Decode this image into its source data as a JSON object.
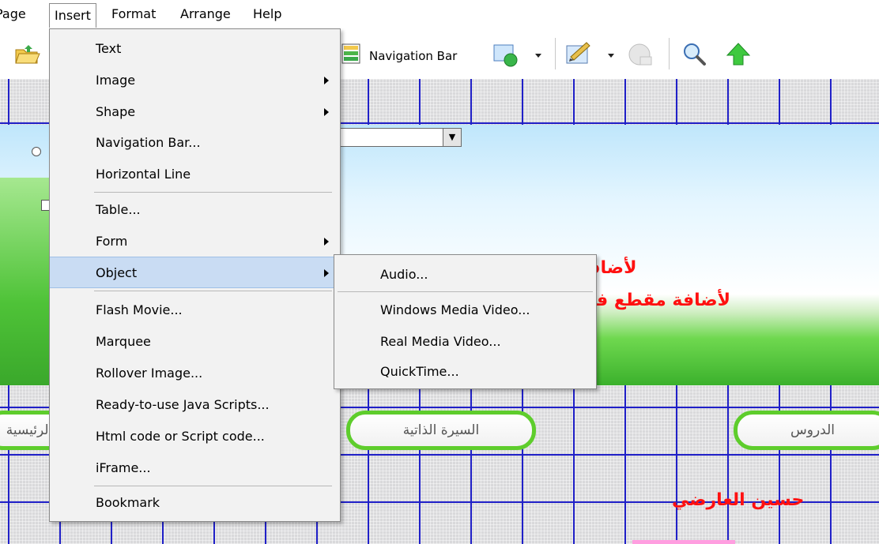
{
  "menubar": {
    "items": [
      {
        "label": "Page"
      },
      {
        "label": "Insert"
      },
      {
        "label": "Format"
      },
      {
        "label": "Arrange"
      },
      {
        "label": "Help"
      }
    ]
  },
  "toolbar": {
    "navigation_bar_label": "Navigation Bar"
  },
  "insert_menu": {
    "items": [
      {
        "label": "Text"
      },
      {
        "label": "Image"
      },
      {
        "label": "Shape"
      },
      {
        "label": "Navigation Bar..."
      },
      {
        "label": "Horizontal Line"
      },
      {
        "label": "Table..."
      },
      {
        "label": "Form"
      },
      {
        "label": "Object"
      },
      {
        "label": "Flash Movie..."
      },
      {
        "label": "Marquee"
      },
      {
        "label": "Rollover Image..."
      },
      {
        "label": "Ready-to-use Java Scripts..."
      },
      {
        "label": "Html code or Script code..."
      },
      {
        "label": "iFrame..."
      },
      {
        "label": "Bookmark"
      }
    ]
  },
  "object_submenu": {
    "items": [
      {
        "label": "Audio..."
      },
      {
        "label": "Windows Media Video..."
      },
      {
        "label": "Real Media Video..."
      },
      {
        "label": "QuickTime..."
      }
    ]
  },
  "page": {
    "nav_buttons": [
      {
        "label": "الرئيسية"
      },
      {
        "label": "السيرة الذاتية"
      },
      {
        "label": "الدروس"
      }
    ],
    "annotations": {
      "audio_note": "لأضافة مقطع صوتي",
      "video_note": "لأضافة مقطع فديو",
      "author": "حسين العارضي"
    }
  },
  "colors": {
    "grid_line": "#2020c8",
    "button_border": "#5ecd2c",
    "annotation_red": "#ff1010",
    "menu_highlight": "#c9dcf3"
  }
}
